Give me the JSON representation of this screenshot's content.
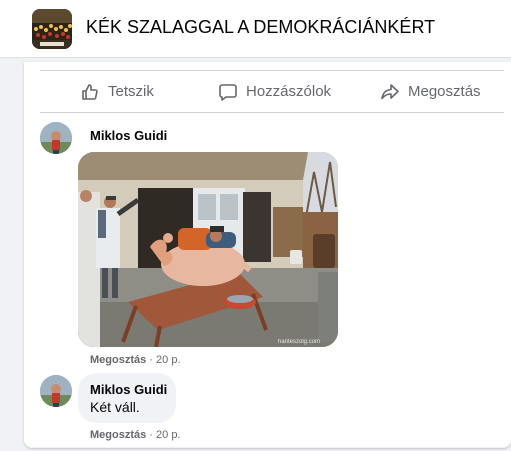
{
  "group": {
    "title": "KÉK SZALAGGAL A DEMOKRÁCIÁNKÉRT",
    "avatar_label": "KÉK SZALAGGAL"
  },
  "actions": {
    "like": "Tetszik",
    "comment": "Hozzászólok",
    "share": "Megosztás"
  },
  "comments": [
    {
      "author": "Miklos Guidi",
      "image_watermark": "hanteszolg.com",
      "meta_action": "Megosztás",
      "meta_sep": " · ",
      "meta_time": "20 p."
    },
    {
      "author": "Miklos Guidi",
      "text": "Két váll.",
      "meta_action": "Megosztás",
      "meta_sep": " · ",
      "meta_time": "20 p."
    }
  ],
  "icons": {
    "like": "thumbs-up-icon",
    "comment": "speech-bubble-icon",
    "share": "share-arrow-icon"
  },
  "colors": {
    "icon_gray": "#65676b",
    "text": "#050505",
    "divider": "#ced0d4",
    "background": "#f0f2f5"
  }
}
